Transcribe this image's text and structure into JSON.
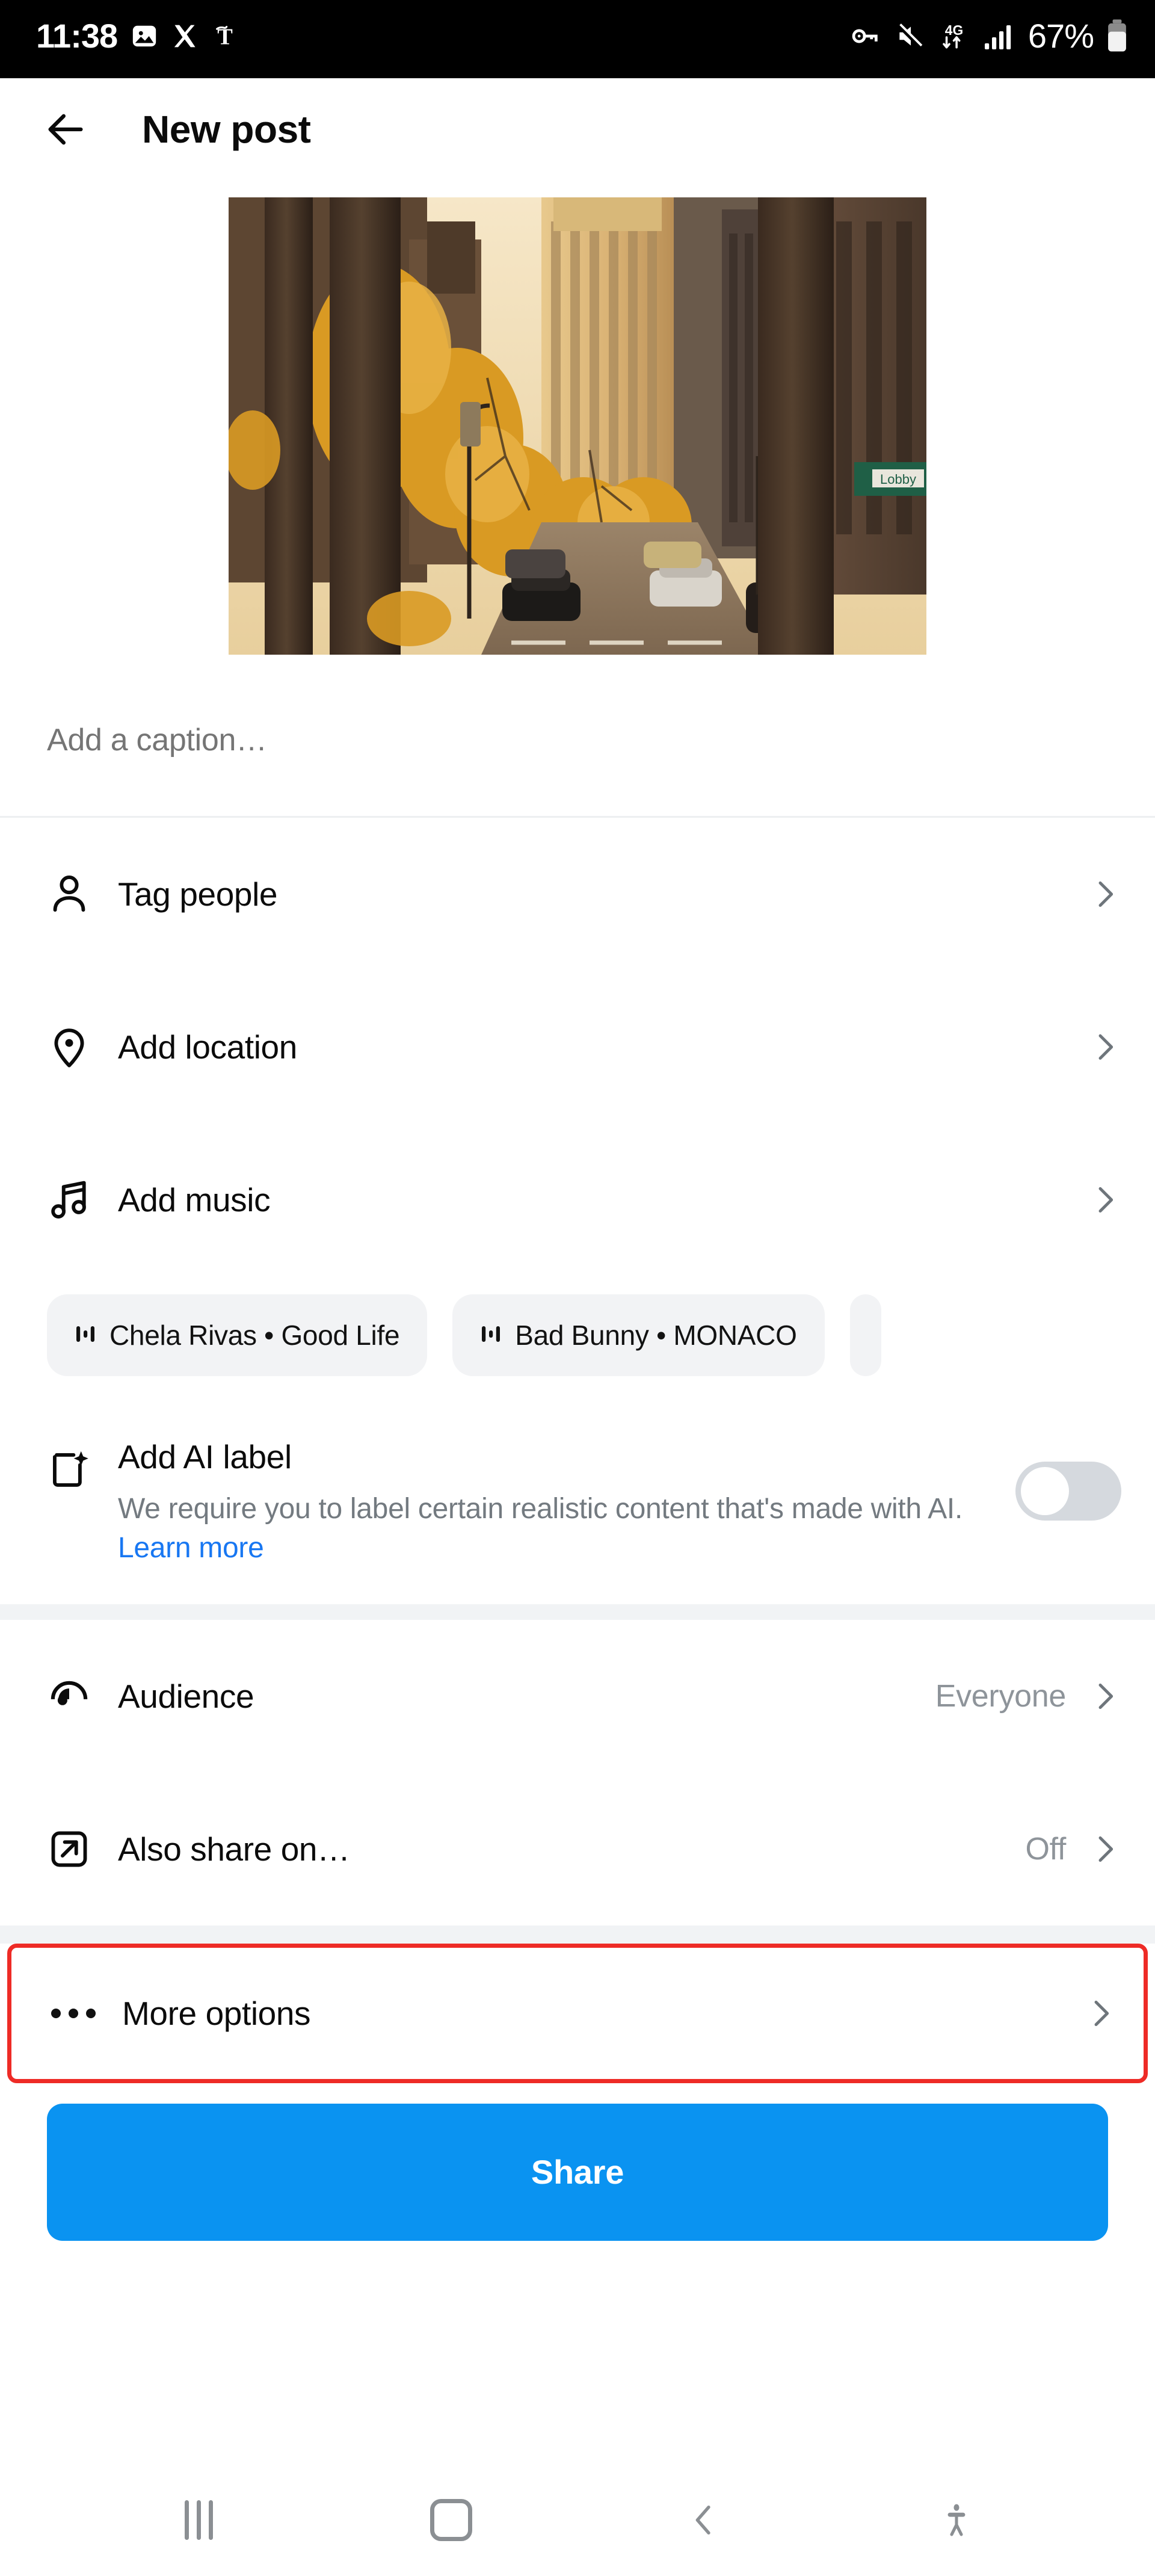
{
  "status_bar": {
    "time": "11:38",
    "left_icons": [
      "photo-icon",
      "x-app-icon",
      "nyt-app-icon"
    ],
    "right_icons": [
      "vpn-key-icon",
      "mute-icon",
      "network-4g-icon",
      "signal-bars-icon",
      "battery-icon"
    ],
    "network": "4G",
    "battery_percent": "67%"
  },
  "header": {
    "back_label": "Back",
    "title": "New post"
  },
  "preview": {
    "alt": "Autumn city street with golden trees and tall buildings"
  },
  "caption": {
    "placeholder": "Add a caption…",
    "value": ""
  },
  "options": [
    {
      "label": "Tag people",
      "icon": "person-icon",
      "value": ""
    },
    {
      "label": "Add location",
      "icon": "location-pin-icon",
      "value": ""
    },
    {
      "label": "Add music",
      "icon": "music-note-icon",
      "value": ""
    }
  ],
  "music_suggestions": [
    {
      "label": "Chela Rivas • Good Life",
      "icon": "audio-wave-icon"
    },
    {
      "label": "Bad Bunny • MONACO",
      "icon": "audio-wave-icon"
    }
  ],
  "ai_label": {
    "icon": "ai-sparkle-icon",
    "title": "Add AI label",
    "description": "We require you to label certain realistic content that's made with AI.",
    "link_text": "Learn more",
    "toggle_state": "off"
  },
  "settings": [
    {
      "label": "Audience",
      "icon": "audience-icon",
      "value": "Everyone"
    },
    {
      "label": "Also share on…",
      "icon": "share-arrow-icon",
      "value": "Off"
    }
  ],
  "more_options": {
    "label": "More options",
    "icon": "ellipsis-icon",
    "highlight_color": "#EE2B26"
  },
  "share": {
    "label": "Share",
    "color": "#0A93F1"
  },
  "nav_bar": {
    "items": [
      "recents-icon",
      "home-icon",
      "back-icon",
      "accessibility-icon"
    ]
  },
  "colors": {
    "accent": "#0A93F1",
    "link": "#1877F2",
    "muted_text": "#737A80",
    "chip_bg": "#F2F3F5",
    "highlight": "#EE2B26"
  }
}
